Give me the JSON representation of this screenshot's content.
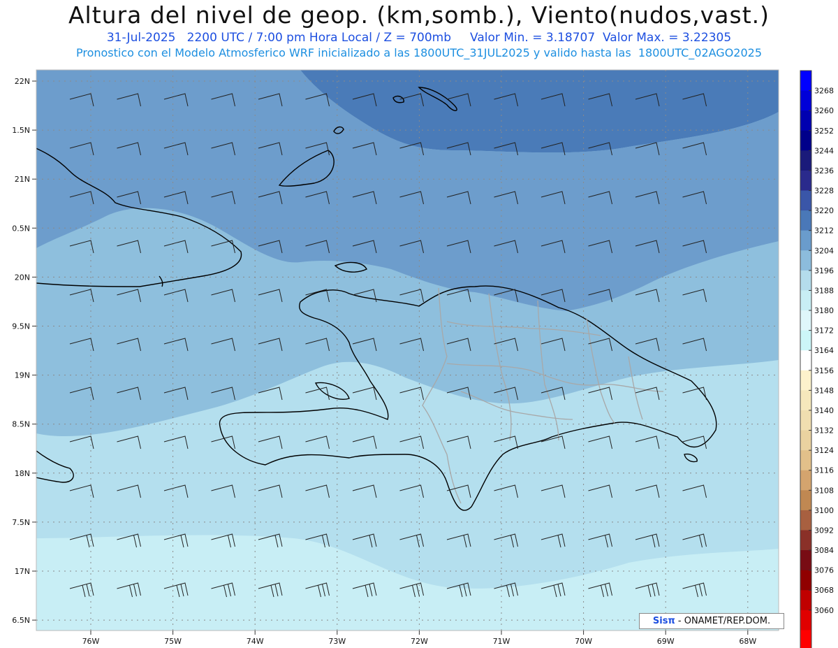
{
  "header": {
    "title": "Altura del nivel de geop. (km,somb.), Viento(nudos,vast.)",
    "subtitle1": "31-Jul-2025   2200 UTC / 7:00 pm Hora Local / Z = 700mb     Valor Min. = 3.18707  Valor Max. = 3.22305",
    "subtitle2": "Pronostico con el Modelo Atmosferico WRF inicializado a las 1800UTC_31JUL2025 y valido hasta las  1800UTC_02AGO2025"
  },
  "map": {
    "lat_labels": [
      "22N",
      "1.5N",
      "21N",
      "0.5N",
      "20N",
      "9.5N",
      "19N",
      "8.5N",
      "18N",
      "7.5N",
      "17N",
      "6.5N"
    ],
    "lon_labels": [
      "76W",
      "75W",
      "74W",
      "73W",
      "72W",
      "71W",
      "70W",
      "69W",
      "68W"
    ]
  },
  "colorbar": {
    "levels": [
      "3268",
      "3260",
      "3252",
      "3244",
      "3236",
      "3228",
      "3220",
      "3212",
      "3204",
      "3196",
      "3188",
      "3180",
      "3172",
      "3164",
      "3156",
      "3148",
      "3140",
      "3132",
      "3124",
      "3116",
      "3108",
      "3100",
      "3092",
      "3084",
      "3076",
      "3068",
      "3060"
    ],
    "colors": [
      "#0000ff",
      "#0000d8",
      "#0000b0",
      "#00008a",
      "#1a1a7a",
      "#2a2a8c",
      "#3a56a8",
      "#4a78b8",
      "#6a9ccc",
      "#8cbcdc",
      "#b4dcec",
      "#c8eef4",
      "#dff6fa",
      "#ccf6f8",
      "#ffffff",
      "#fdf2cc",
      "#f6e8bc",
      "#f0deb0",
      "#ead2a0",
      "#e2c08a",
      "#d4a46e",
      "#c08852",
      "#a86040",
      "#8a3028",
      "#780c14",
      "#900000",
      "#c00000",
      "#e00000",
      "#ff0000"
    ]
  },
  "credit": {
    "logo": "Sisπ",
    "text": " - ONAMET/REP.DOM."
  },
  "colors": {
    "field_high": "#4a7bb8",
    "field_mid": "#6d9dcc",
    "field_low": "#8ebfdd",
    "field_lower": "#b4dfee",
    "field_lowest": "#c8eef5",
    "coast": "#000000",
    "borders": "#a8a8a8"
  }
}
